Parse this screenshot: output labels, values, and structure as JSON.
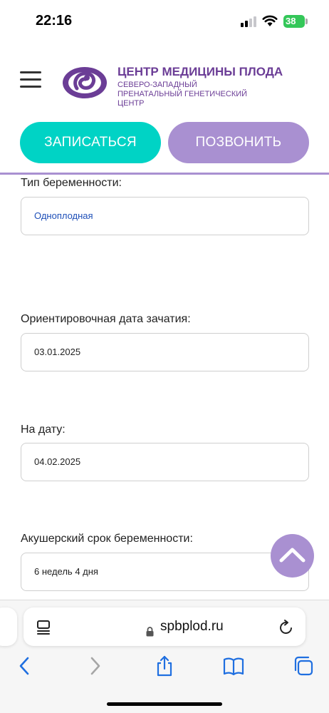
{
  "status_bar": {
    "time": "22:16",
    "battery": "38"
  },
  "header": {
    "brand_title": "ЦЕНТР МЕДИЦИНЫ ПЛОДА",
    "brand_subtitle": "СЕВЕРО-ЗАПАДНЫЙ ПРЕНАТАЛЬНЫЙ ГЕНЕТИЧЕСКИЙ ЦЕНТР",
    "signup_label": "ЗАПИСАТЬСЯ",
    "call_label": "ПОЗВОНИТЬ"
  },
  "form": {
    "pregnancy_type_label": "Тип беременности:",
    "pregnancy_type_value": "Одноплодная",
    "conception_date_label": "Ориентировочная дата зачатия:",
    "conception_date_value": "03.01.2025",
    "on_date_label": "На дату:",
    "on_date_value": "04.02.2025",
    "obstetric_term_label": "Акушерский срок беременности:",
    "obstetric_term_value": "6 недель 4 дня"
  },
  "browser": {
    "url": "spbplod.ru"
  },
  "colors": {
    "accent_teal": "#00d3c5",
    "accent_purple": "#a990d1",
    "brand_purple": "#6b3d96",
    "battery_green": "#34c759"
  },
  "icons": [
    "signal-icon",
    "wifi-icon",
    "battery-icon",
    "menu-icon",
    "logo-icon",
    "chevron-up-icon",
    "reader-icon",
    "lock-icon",
    "reload-icon",
    "back-icon",
    "forward-icon",
    "share-icon",
    "bookmarks-icon",
    "tabs-icon"
  ]
}
